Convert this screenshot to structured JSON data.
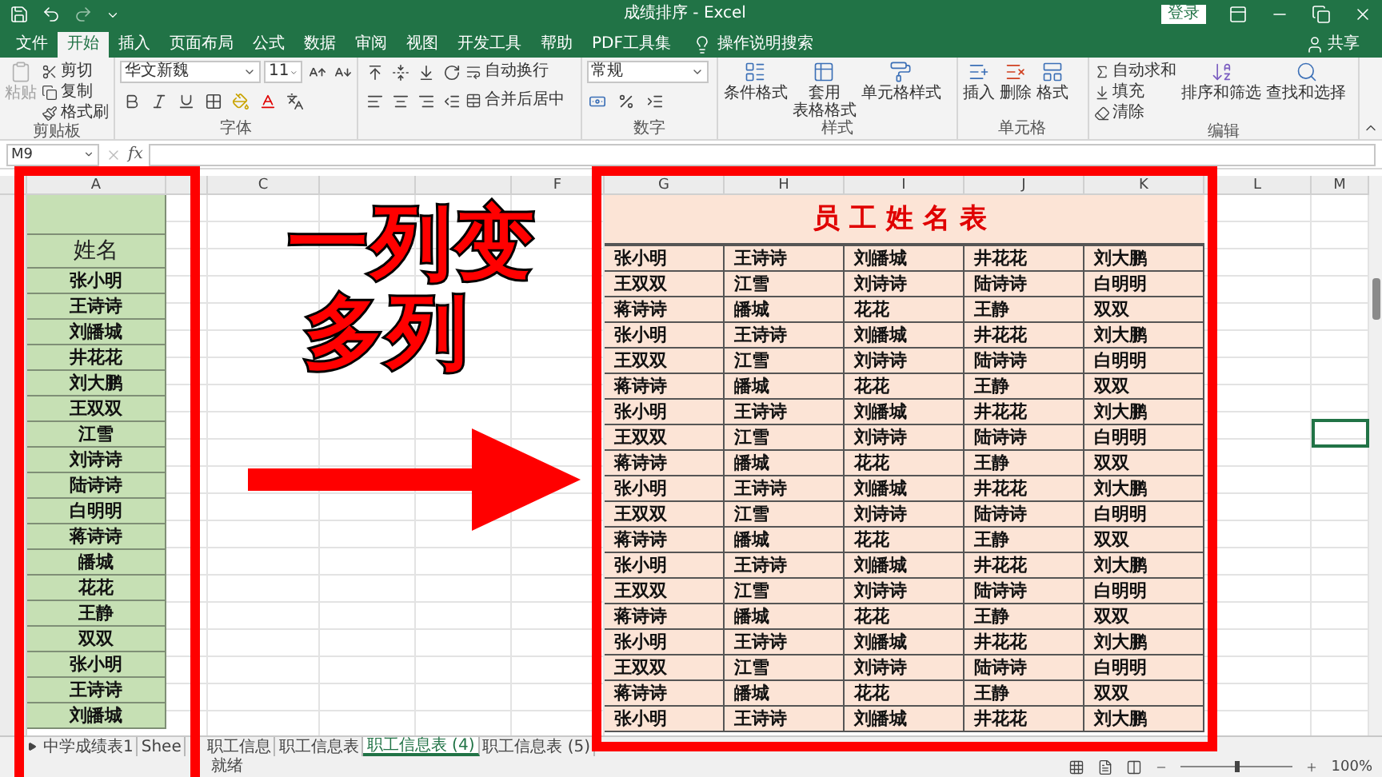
{
  "window": {
    "title": "成绩排序 - Excel",
    "sign_in": "登录",
    "share": "共享"
  },
  "ribbon_tabs": [
    {
      "label": "文件",
      "selected": false
    },
    {
      "label": "开始",
      "selected": true
    },
    {
      "label": "插入",
      "selected": false
    },
    {
      "label": "页面布局",
      "selected": false
    },
    {
      "label": "公式",
      "selected": false
    },
    {
      "label": "数据",
      "selected": false
    },
    {
      "label": "审阅",
      "selected": false
    },
    {
      "label": "视图",
      "selected": false
    },
    {
      "label": "开发工具",
      "selected": false
    },
    {
      "label": "帮助",
      "selected": false
    },
    {
      "label": "PDF工具集",
      "selected": false
    }
  ],
  "tell_me": "操作说明搜索",
  "ribbon": {
    "clipboard": {
      "paste": {
        "label": "粘贴",
        "disabled": true
      },
      "cut": "剪切",
      "copy": "复制",
      "format_painter": "格式刷",
      "label": "剪贴板"
    },
    "font": {
      "name": "华文新魏",
      "size": "11",
      "label": "字体"
    },
    "alignment": {
      "wrap": "自动换行",
      "merge": "合并后居中"
    },
    "number": {
      "format": "常规",
      "label": "数字"
    },
    "styles": {
      "items": [
        {
          "lines": [
            "条件格式"
          ]
        },
        {
          "lines": [
            "套用",
            "表格格式"
          ]
        },
        {
          "lines": [
            "单元格样式"
          ]
        }
      ],
      "label": "样式"
    },
    "cells": {
      "items": [
        "插入",
        "删除",
        "格式"
      ],
      "label": "单元格"
    },
    "editing": {
      "autosum": "自动求和",
      "fill": "填充",
      "clear": "清除",
      "sort": "排序和筛选",
      "find": "查找和选择",
      "label": "编辑"
    }
  },
  "formula_bar": {
    "name_box": "M9",
    "function_symbol": "fx"
  },
  "columns": [
    "A",
    "C",
    "F",
    "G",
    "H",
    "I",
    "J",
    "K",
    "L",
    "M"
  ],
  "name_column": {
    "header": "姓名",
    "names": [
      "张小明",
      "王诗诗",
      "刘皤城",
      "井花花",
      "刘大鹏",
      "王双双",
      "江雪",
      "刘诗诗",
      "陆诗诗",
      "白明明",
      "蒋诗诗",
      "皤城",
      "花花",
      "王静",
      "双双",
      "张小明",
      "王诗诗",
      "刘皤城"
    ]
  },
  "name_table": {
    "title": "员工姓名表",
    "rows": [
      [
        "张小明",
        "王诗诗",
        "刘皤城",
        "井花花",
        "刘大鹏"
      ],
      [
        "王双双",
        "江雪",
        "刘诗诗",
        "陆诗诗",
        "白明明"
      ],
      [
        "蒋诗诗",
        "皤城",
        "花花",
        "王静",
        "双双"
      ],
      [
        "张小明",
        "王诗诗",
        "刘皤城",
        "井花花",
        "刘大鹏"
      ],
      [
        "王双双",
        "江雪",
        "刘诗诗",
        "陆诗诗",
        "白明明"
      ],
      [
        "蒋诗诗",
        "皤城",
        "花花",
        "王静",
        "双双"
      ],
      [
        "张小明",
        "王诗诗",
        "刘皤城",
        "井花花",
        "刘大鹏"
      ],
      [
        "王双双",
        "江雪",
        "刘诗诗",
        "陆诗诗",
        "白明明"
      ],
      [
        "蒋诗诗",
        "皤城",
        "花花",
        "王静",
        "双双"
      ],
      [
        "张小明",
        "王诗诗",
        "刘皤城",
        "井花花",
        "刘大鹏"
      ],
      [
        "王双双",
        "江雪",
        "刘诗诗",
        "陆诗诗",
        "白明明"
      ],
      [
        "蒋诗诗",
        "皤城",
        "花花",
        "王静",
        "双双"
      ],
      [
        "张小明",
        "王诗诗",
        "刘皤城",
        "井花花",
        "刘大鹏"
      ],
      [
        "王双双",
        "江雪",
        "刘诗诗",
        "陆诗诗",
        "白明明"
      ],
      [
        "蒋诗诗",
        "皤城",
        "花花",
        "王静",
        "双双"
      ],
      [
        "张小明",
        "王诗诗",
        "刘皤城",
        "井花花",
        "刘大鹏"
      ],
      [
        "王双双",
        "江雪",
        "刘诗诗",
        "陆诗诗",
        "白明明"
      ],
      [
        "蒋诗诗",
        "皤城",
        "花花",
        "王静",
        "双双"
      ],
      [
        "张小明",
        "王诗诗",
        "刘皤城",
        "井花花",
        "刘大鹏"
      ]
    ]
  },
  "overlay": {
    "caption_lines": [
      "一列变",
      "多列"
    ]
  },
  "sheet_tabs": [
    {
      "label": "中学成绩表1",
      "selected": false
    },
    {
      "label": "Shee",
      "selected": false
    },
    {
      "label": "职工信息",
      "selected": false
    },
    {
      "label": "职工信息表",
      "selected": false
    },
    {
      "label": "职工信息表 (4)",
      "selected": true
    },
    {
      "label": "职工信息表 (5)",
      "selected": false
    }
  ],
  "status_bar": {
    "text": "就绪",
    "zoom": {
      "level": 0.5,
      "reading": "100%"
    }
  }
}
